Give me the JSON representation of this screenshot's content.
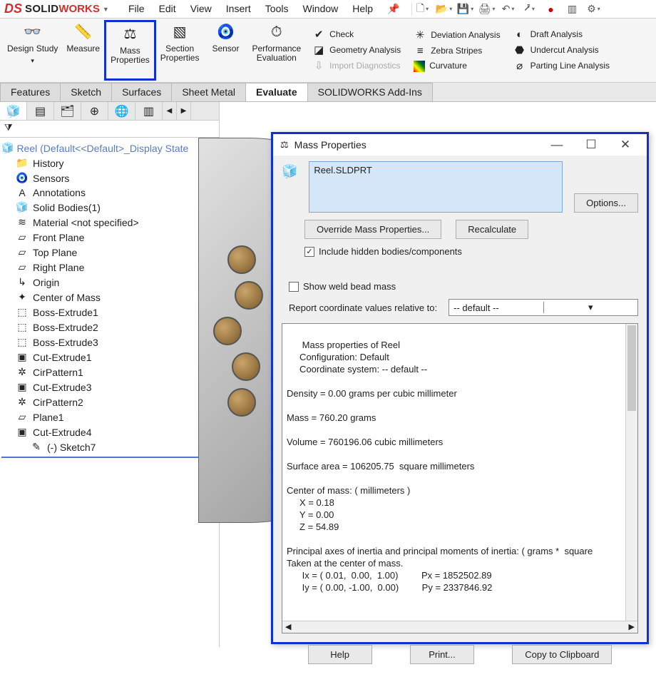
{
  "app": {
    "brand_ds": "DS",
    "brand_solid": "SOLID",
    "brand_works": "WORKS"
  },
  "menu": {
    "file": "File",
    "edit": "Edit",
    "view": "View",
    "insert": "Insert",
    "tools": "Tools",
    "window": "Window",
    "help": "Help"
  },
  "ribbon": {
    "design_study": "Design Study",
    "measure": "Measure",
    "mass_properties": "Mass\nProperties",
    "section_properties": "Section\nProperties",
    "sensor": "Sensor",
    "perf_eval": "Performance\nEvaluation",
    "check": "Check",
    "geom_analysis": "Geometry Analysis",
    "import_diag": "Import Diagnostics",
    "deviation": "Deviation Analysis",
    "zebra": "Zebra Stripes",
    "curvature": "Curvature",
    "draft": "Draft Analysis",
    "undercut": "Undercut Analysis",
    "parting": "Parting Line Analysis"
  },
  "tabs": {
    "features": "Features",
    "sketch": "Sketch",
    "surfaces": "Surfaces",
    "sheet_metal": "Sheet Metal",
    "evaluate": "Evaluate",
    "addins": "SOLIDWORKS Add-Ins"
  },
  "tree": {
    "root": "Reel  (Default<<Default>_Display State",
    "items": [
      {
        "icon": "📁",
        "label": "History"
      },
      {
        "icon": "🧿",
        "label": "Sensors"
      },
      {
        "icon": "A",
        "label": "Annotations"
      },
      {
        "icon": "🧊",
        "label": "Solid Bodies(1)"
      },
      {
        "icon": "≋",
        "label": "Material <not specified>"
      },
      {
        "icon": "▱",
        "label": "Front Plane"
      },
      {
        "icon": "▱",
        "label": "Top Plane"
      },
      {
        "icon": "▱",
        "label": "Right Plane"
      },
      {
        "icon": "↳",
        "label": "Origin"
      },
      {
        "icon": "✦",
        "label": "Center of Mass"
      },
      {
        "icon": "⬚",
        "label": "Boss-Extrude1"
      },
      {
        "icon": "⬚",
        "label": "Boss-Extrude2"
      },
      {
        "icon": "⬚",
        "label": "Boss-Extrude3"
      },
      {
        "icon": "▣",
        "label": "Cut-Extrude1"
      },
      {
        "icon": "✲",
        "label": "CirPattern1"
      },
      {
        "icon": "▣",
        "label": "Cut-Extrude3"
      },
      {
        "icon": "✲",
        "label": "CirPattern2"
      },
      {
        "icon": "▱",
        "label": "Plane1"
      },
      {
        "icon": "▣",
        "label": "Cut-Extrude4"
      }
    ],
    "child": {
      "icon": "✎",
      "label": "(-) Sketch7"
    }
  },
  "dialog": {
    "title": "Mass Properties",
    "file": "Reel.SLDPRT",
    "options_btn": "Options...",
    "override_btn": "Override Mass Properties...",
    "recalc_btn": "Recalculate",
    "include_hidden": "Include hidden bodies/components",
    "show_weld": "Show weld bead mass",
    "coord_label": "Report coordinate values relative to:",
    "coord_value": "-- default --",
    "help_btn": "Help",
    "print_btn": "Print...",
    "copy_btn": "Copy to Clipboard",
    "results_text": "Mass properties of Reel\n     Configuration: Default\n     Coordinate system: -- default --\n\nDensity = 0.00 grams per cubic millimeter\n\nMass = 760.20 grams\n\nVolume = 760196.06 cubic millimeters\n\nSurface area = 106205.75  square millimeters\n\nCenter of mass: ( millimeters )\n     X = 0.18\n     Y = 0.00\n     Z = 54.89\n\nPrincipal axes of inertia and principal moments of inertia: ( grams *  square\nTaken at the center of mass.\n      Ix = ( 0.01,  0.00,  1.00)         Px = 1852502.89\n      Iy = ( 0.00, -1.00,  0.00)         Py = 2337846.92"
  }
}
